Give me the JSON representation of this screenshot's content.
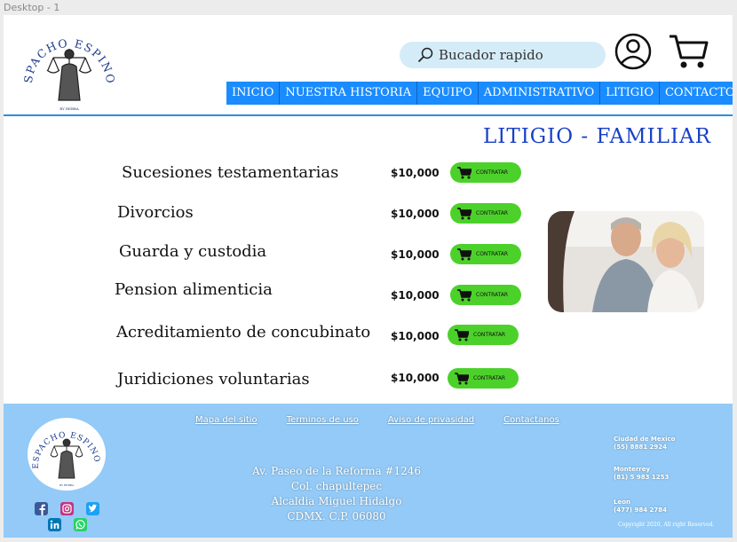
{
  "frame_label": "Desktop - 1",
  "logo": {
    "text": "DESPACHO ESPINOZA",
    "tagline": "BY REBBA"
  },
  "search": {
    "placeholder": "Bucador rapido"
  },
  "nav": {
    "items": [
      "INICIO",
      "NUESTRA HISTORIA",
      "EQUIPO",
      "ADMINISTRATIVO",
      "LITIGIO",
      "CONTACTO"
    ]
  },
  "main": {
    "title": "LITIGIO - FAMILIAR",
    "services": [
      {
        "name": "Sucesiones testamentarias",
        "price": "$10,000",
        "button": "CONTRATAR"
      },
      {
        "name": "Divorcios",
        "price": "$10,000",
        "button": "CONTRATAR"
      },
      {
        "name": "Guarda y custodia",
        "price": "$10,000",
        "button": "CONTRATAR"
      },
      {
        "name": "Pension alimenticia",
        "price": "$10,000",
        "button": "CONTRATAR"
      },
      {
        "name": "Acreditamiento de concubinato",
        "price": "$10,000",
        "button": "CONTRATAR"
      },
      {
        "name": "Juridiciones voluntarias",
        "price": "$10,000",
        "button": "CONTRATAR"
      }
    ]
  },
  "footer": {
    "links": [
      "Mapa del sitio",
      "Terminos de uso",
      "Aviso de privasidad",
      "Contactanos"
    ],
    "address": [
      "Av. Paseo de la Reforma #1246",
      "Col. chapultepec",
      "Alcaldia Miguel Hidalgo",
      "CDMX. C.P. 06080"
    ],
    "offices": [
      {
        "city": "Ciudad de Mexico",
        "phone": "(55) 8881 2924"
      },
      {
        "city": "Monterrey",
        "phone": "(81) 5 983 1253"
      },
      {
        "city": "Leon",
        "phone": "(477) 984 2784"
      }
    ],
    "copyright": "Copyright 2020, All right Reserved.",
    "social_icons": [
      "facebook-icon",
      "instagram-icon",
      "twitter-icon",
      "linkedin-icon",
      "whatsapp-icon"
    ]
  },
  "colors": {
    "nav": "#1a8cff",
    "title": "#1840c8",
    "button": "#4cd12b",
    "footer": "#93caf7",
    "search": "#d4ecf7"
  }
}
